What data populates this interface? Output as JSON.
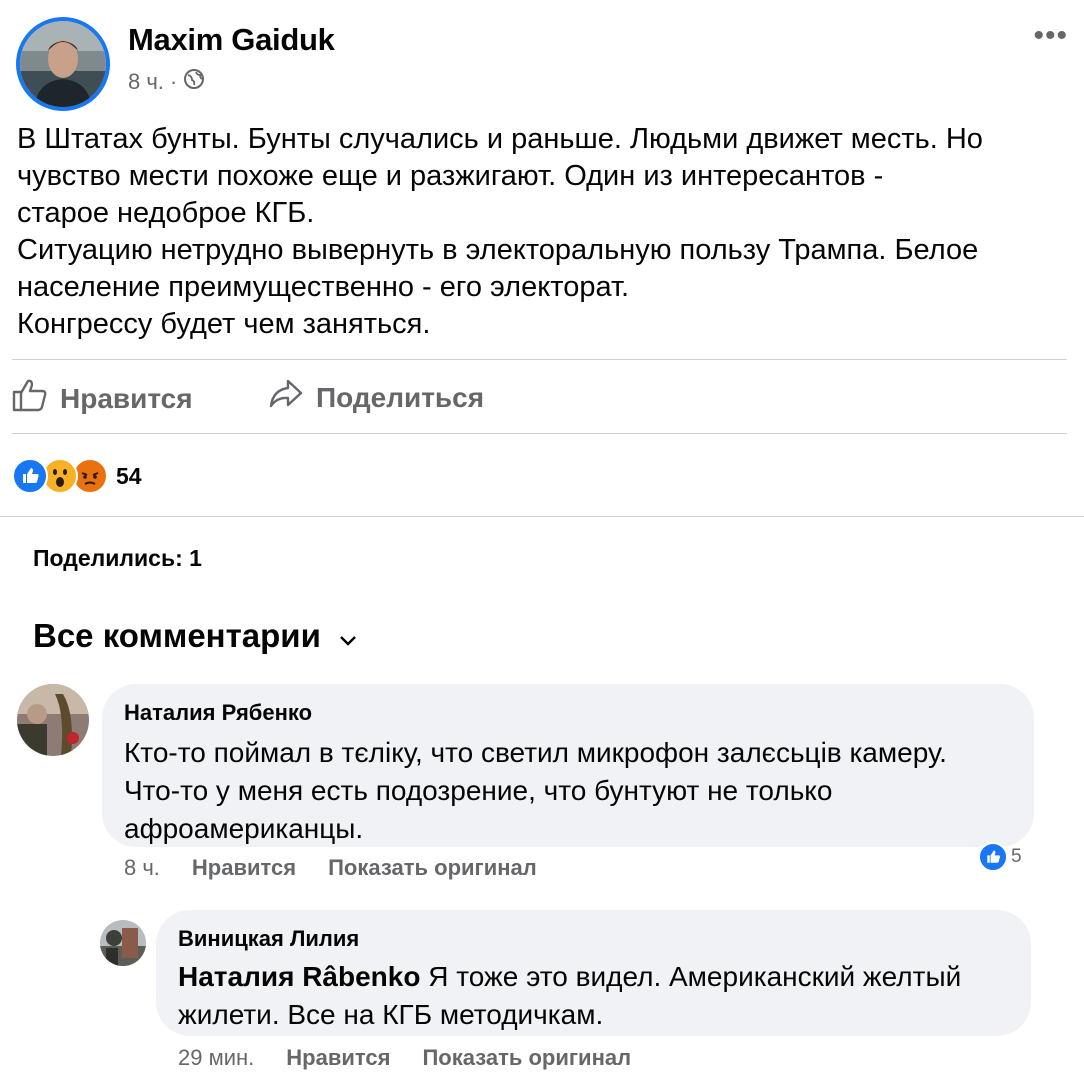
{
  "post": {
    "author": "Maxim Gaiduk",
    "time": "8 ч.",
    "dot": "·",
    "text": "В Штатах бунты. Бунты случались и раньше. Людьми движет месть. Но\nчувство мести похоже еще и разжигают. Один из интересантов -\nстарое недоброе КГБ.\nСитуацию нетрудно вывернуть в электоральную пользу Трампа. Белое\nнаселение преимущественно - его электорат.\nКонгрессу будет чем заняться."
  },
  "actions": {
    "like": "Нравится",
    "share": "Поделиться"
  },
  "reactions": {
    "count": "54",
    "types": [
      "like-icon",
      "wow-icon",
      "angry-icon"
    ]
  },
  "shared": "Поделились: 1",
  "comments_header": "Все комментарии",
  "comments": [
    {
      "name": "Наталия Рябенко",
      "text": "Кто-то поймал в тєліку, что светил микрофон залєсьців камеру.\nЧто-то у меня есть подозрение, что бунтуют не только\nафроамериканцы.",
      "time": "8 ч.",
      "like": "Нравится",
      "translate": "Показать оригинал",
      "reactions": "5"
    },
    {
      "name": "Виницкая Лилия",
      "mention": "Наталия Râbenko",
      "text": " Я тоже это видел. Американский желтый\nжилети. Все на КГБ методичкам.",
      "time": "29 мин.",
      "like": "Нравится",
      "translate": "Показать оригинал"
    }
  ],
  "colors": {
    "accent": "#1877f2",
    "muted": "#65676b",
    "bubble": "#f0f2f5",
    "wow": "#f7b125",
    "angry": "#e9710f"
  }
}
